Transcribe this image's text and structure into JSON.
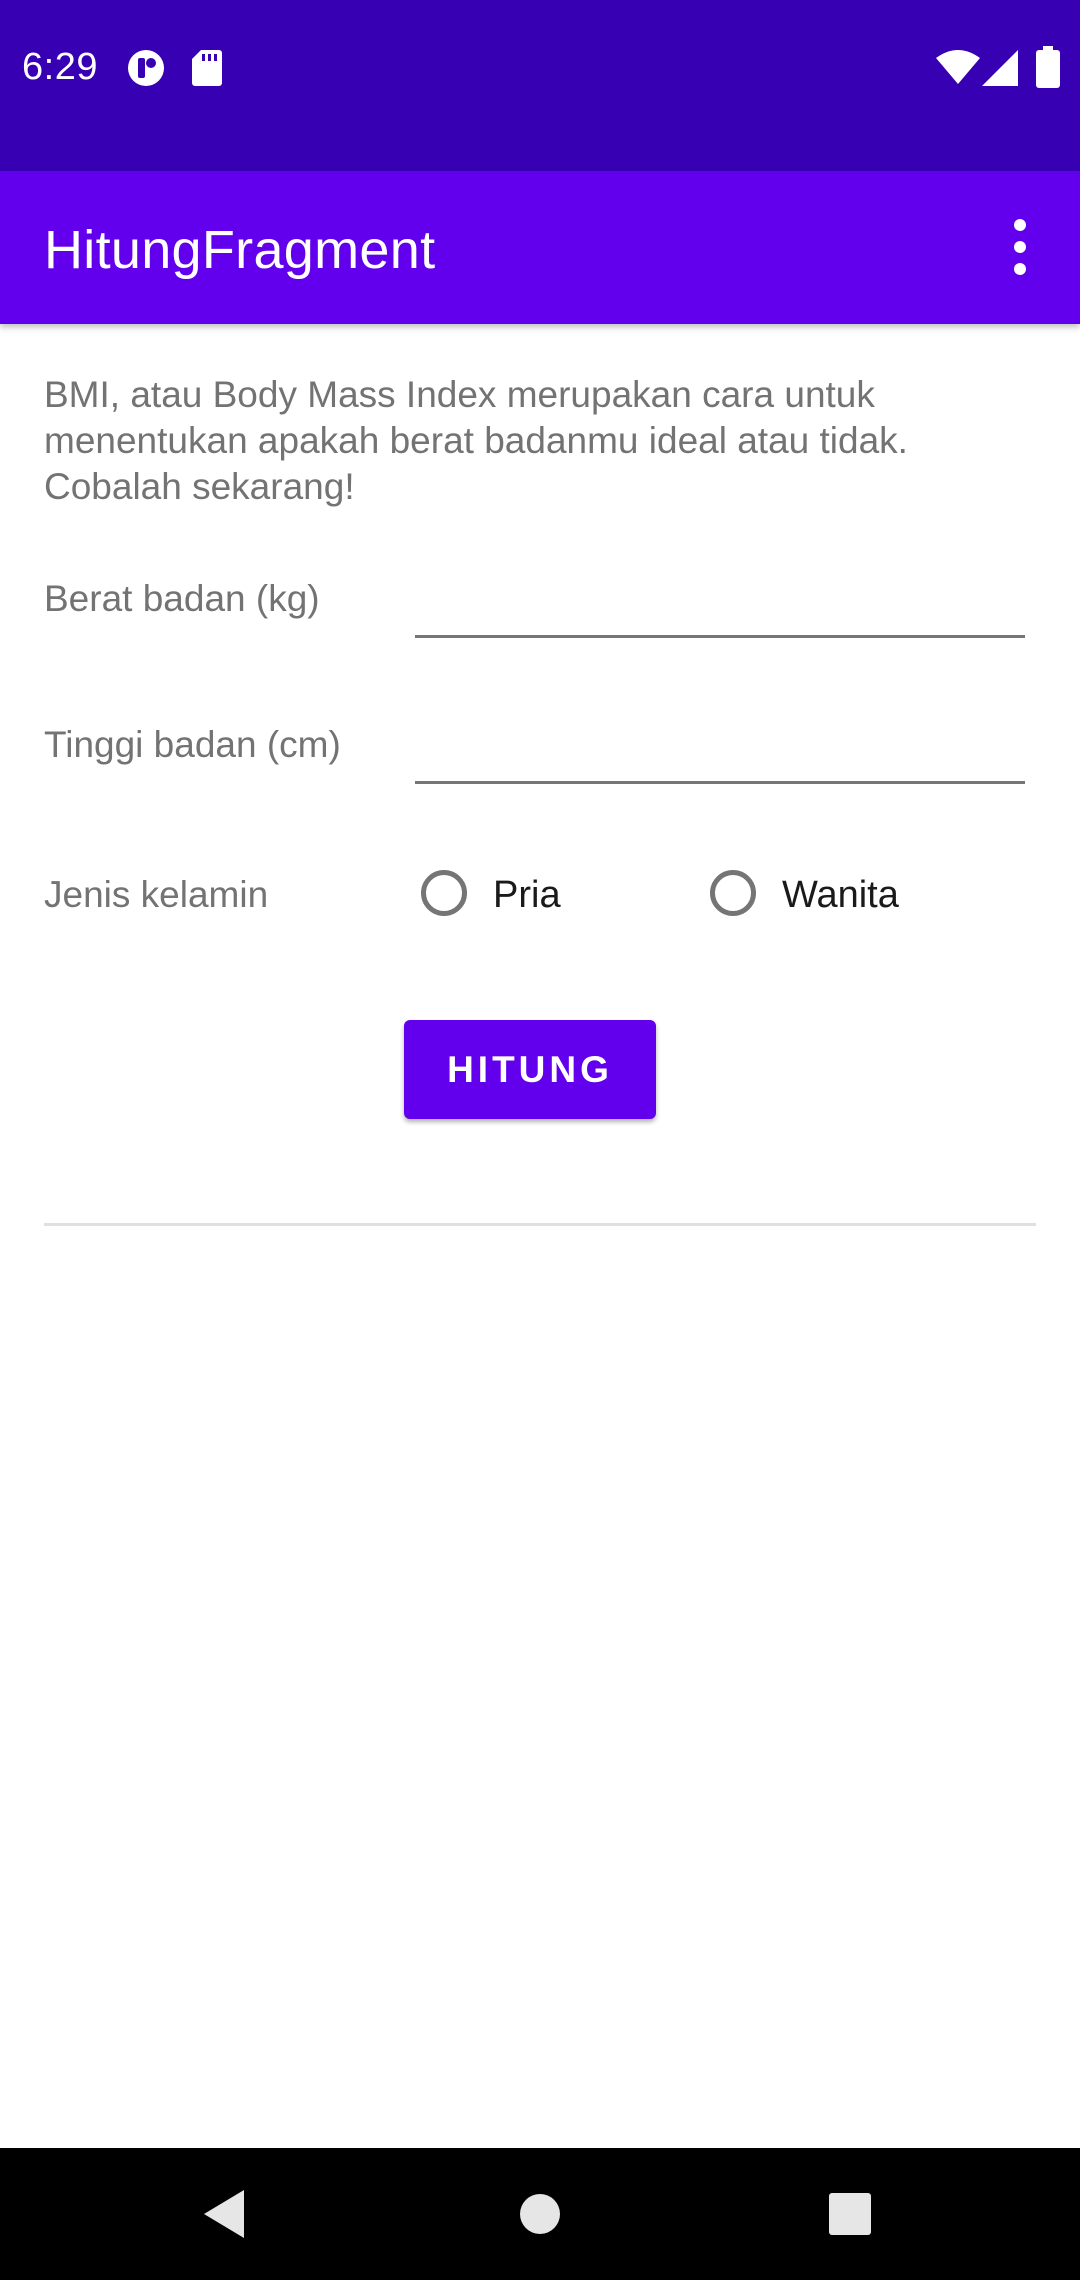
{
  "status_bar": {
    "time": "6:29",
    "icons": [
      "notification-app-icon",
      "sd-card-icon",
      "wifi-icon",
      "cell-signal-icon",
      "battery-icon"
    ]
  },
  "app_bar": {
    "title": "HitungFragment",
    "overflow_icon": "more-vert-icon"
  },
  "intro_text": "BMI, atau Body Mass Index merupakan cara untuk menentukan apakah berat badanmu ideal atau tidak. Cobalah sekarang!",
  "form": {
    "weight_label": "Berat badan (kg)",
    "weight_value": "",
    "height_label": "Tinggi badan (cm)",
    "height_value": "",
    "gender_label": "Jenis kelamin",
    "gender_options": [
      "Pria",
      "Wanita"
    ],
    "selected_gender": null
  },
  "button_label": "HITUNG",
  "nav_bar": {
    "buttons": [
      "back-icon",
      "home-icon",
      "recents-icon"
    ]
  },
  "colors": {
    "status_bar": "#3700b3",
    "primary": "#6200ee",
    "label_text": "#737373",
    "nav_bar": "#000000"
  }
}
